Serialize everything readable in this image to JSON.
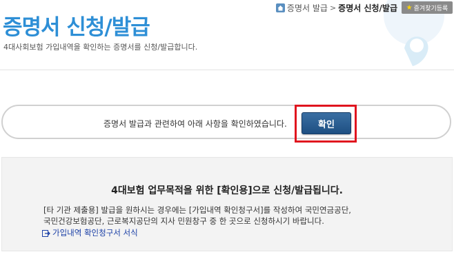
{
  "header": {
    "title": "증명서 신청/발급",
    "subtitle": "4대사회보험 가입내역을 확인하는 증명서를 신청/발급합니다."
  },
  "breadcrumb": {
    "parent": "증명서 발급",
    "separator": ">",
    "current": "증명서 신청/발급"
  },
  "bookmark": {
    "label": "즐겨찾기등록"
  },
  "confirm": {
    "message": "증명서 발급과 관련하여 아래 사항을 확인하였습니다.",
    "button_label": "확인"
  },
  "info": {
    "heading": "4대보험 업무목적을 위한 [확인용]으로 신청/발급됩니다.",
    "body_line1": "[타 기관 제출용] 발급을 원하시는 경우에는 [가입내역 확인청구서]를 작성하여 국민연금공단,",
    "body_line2": "국민건강보험공단, 근로복지공단의 지사 민원창구 중 한 곳으로 신청하시기 바랍니다.",
    "link_label": "가입내역 확인청구서 서식"
  },
  "colors": {
    "title": "#2e8fd6",
    "button": "#1e4f82",
    "highlight": "#e0141e",
    "link": "#1a3fa6"
  },
  "icons": [
    "home-icon",
    "star-icon",
    "link-arrow-icon"
  ]
}
